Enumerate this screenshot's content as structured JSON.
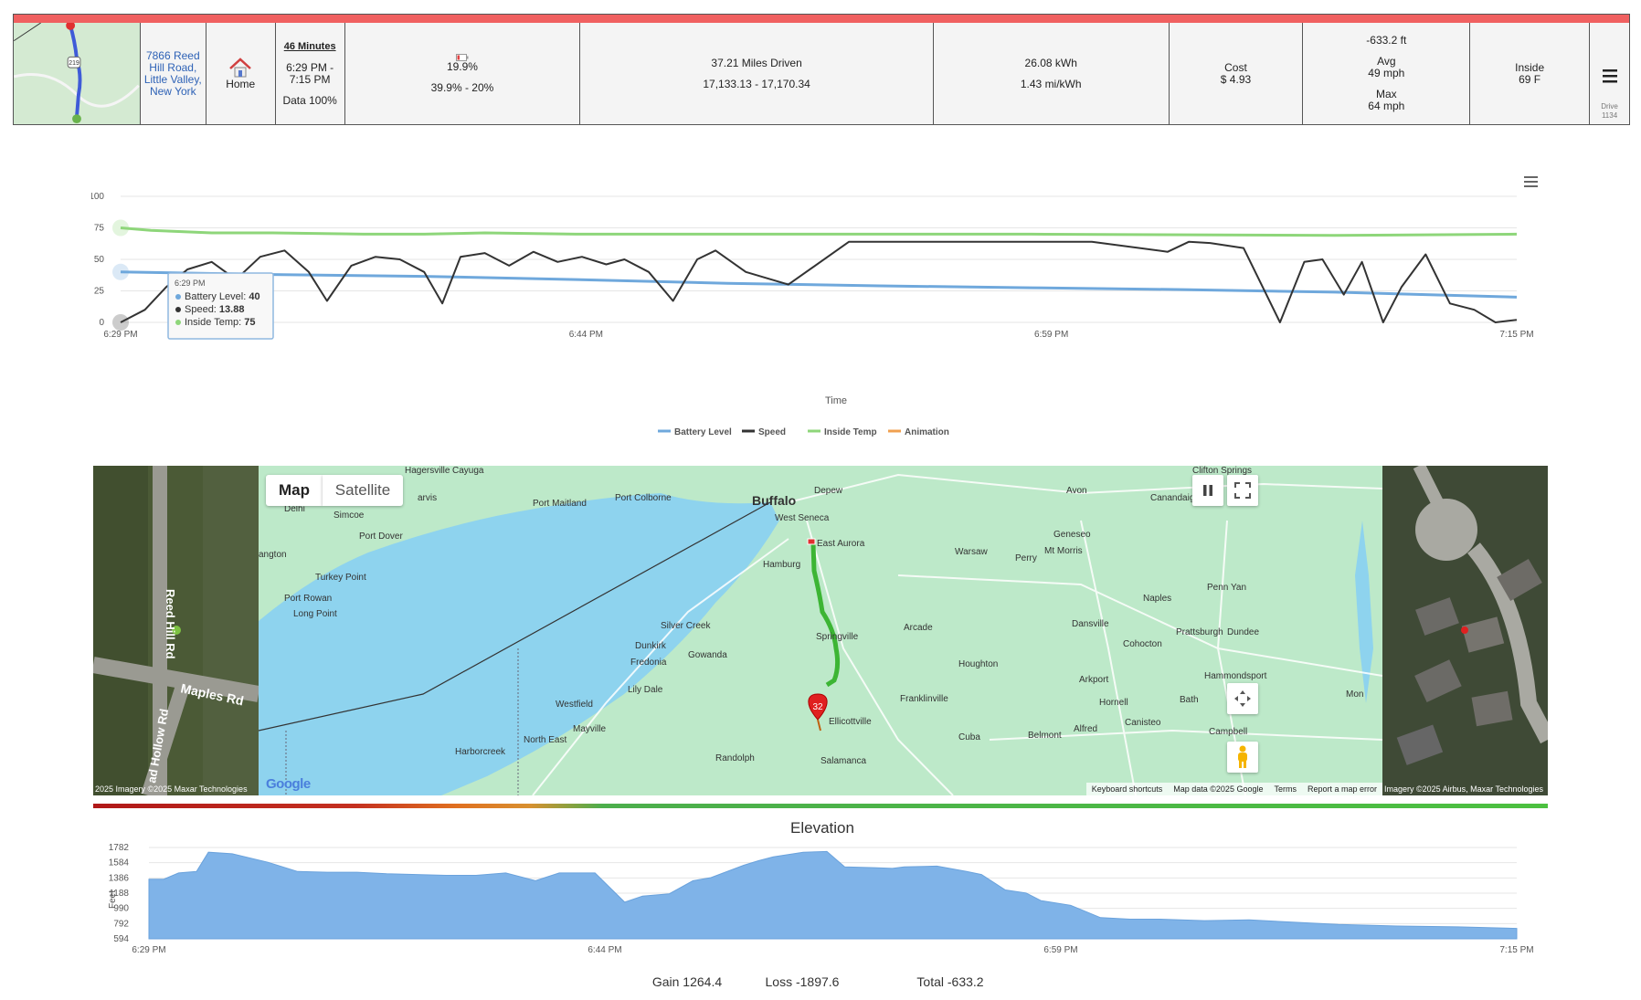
{
  "summary": {
    "address": "7866 Reed Hill Road, Little Valley, New York",
    "home_label": "Home",
    "duration": "46 Minutes",
    "time_range": "6:29 PM - 7:15 PM",
    "data_pct": "Data 100%",
    "battery_now": "19.9%",
    "battery_range": "39.9% - 20%",
    "miles_driven": "37.21 Miles Driven",
    "odometer": "17,133.13 - 17,170.34",
    "energy": "26.08 kWh",
    "efficiency": "1.43 mi/kWh",
    "cost_label": "Cost",
    "cost_value": "$ 4.93",
    "elevation_change": "-633.2 ft",
    "avg_label": "Avg",
    "avg_speed": "49 mph",
    "max_label": "Max",
    "max_speed": "64 mph",
    "inside_label": "Inside",
    "inside_temp": "69 F",
    "drive_label": "Drive",
    "drive_id": "1134",
    "map_route_label": "219"
  },
  "chart_data": [
    {
      "type": "line",
      "xlabel": "Time",
      "x_ticks": [
        "6:29 PM",
        "6:44 PM",
        "6:59 PM",
        "7:15 PM"
      ],
      "y_ticks": [
        "0",
        "25",
        "50",
        "75",
        "100"
      ],
      "ylim": [
        0,
        100
      ],
      "x_minutes_range": [
        0,
        46
      ],
      "legend_position": "bottom",
      "series": [
        {
          "name": "Battery Level",
          "color": "#6fa8dc",
          "x": [
            0,
            5,
            10,
            15,
            20,
            25,
            30,
            35,
            40,
            43,
            46
          ],
          "y": [
            40,
            38,
            36.5,
            34,
            31,
            29,
            27.5,
            26,
            24,
            22,
            20
          ]
        },
        {
          "name": "Speed",
          "color": "#333333",
          "x": [
            0,
            0.8,
            1.5,
            2.2,
            3.0,
            3.8,
            4.6,
            5.4,
            6.2,
            6.8,
            7.6,
            8.4,
            9.2,
            10.0,
            10.6,
            11.2,
            12.0,
            12.8,
            13.6,
            14.4,
            15.2,
            16.0,
            16.6,
            17.4,
            18.2,
            19.0,
            19.6,
            20.6,
            22.0,
            24.0,
            26.0,
            28.0,
            30.0,
            32.0,
            34.5,
            35.2,
            35.9,
            37.0,
            38.2,
            39.0,
            39.6,
            40.3,
            40.9,
            41.6,
            42.2,
            43.0,
            43.8,
            44.6,
            45.3,
            46.0
          ],
          "y": [
            0,
            10,
            28,
            42,
            48,
            34,
            52,
            57,
            40,
            17,
            45,
            52,
            50,
            40,
            15,
            52,
            55,
            45,
            56,
            48,
            52,
            46,
            50,
            40,
            17,
            50,
            57,
            40,
            30,
            64,
            64,
            64,
            64,
            64,
            56,
            64,
            63,
            59,
            0,
            48,
            50,
            22,
            48,
            0,
            28,
            54,
            15,
            10,
            0,
            2
          ]
        },
        {
          "name": "Inside Temp",
          "color": "#8ed67a",
          "x": [
            0,
            1,
            2,
            3,
            5,
            8,
            10,
            12,
            15,
            20,
            30,
            40,
            46
          ],
          "y": [
            75,
            73,
            72,
            71,
            71,
            70,
            70,
            71,
            70,
            70,
            70,
            69,
            70
          ]
        },
        {
          "name": "Animation",
          "color": "#f0a050",
          "x": [],
          "y": []
        }
      ],
      "tooltip": {
        "time": "6:29 PM",
        "lines": [
          {
            "label": "Battery Level:",
            "value": "40",
            "color": "#6fa8dc"
          },
          {
            "label": "Speed:",
            "value": "13.88",
            "color": "#333333"
          },
          {
            "label": "Inside Temp:",
            "value": "75",
            "color": "#8ed67a"
          }
        ]
      }
    },
    {
      "type": "area",
      "title": "Elevation",
      "ylabel": "Feet",
      "x_ticks": [
        "6:29 PM",
        "6:44 PM",
        "6:59 PM",
        "7:15 PM"
      ],
      "y_ticks": [
        "594",
        "792",
        "990",
        "1188",
        "1386",
        "1584",
        "1782"
      ],
      "ylim": [
        594,
        1782
      ],
      "color": "#7fb3e8",
      "x": [
        0,
        0.5,
        1.0,
        1.6,
        2.0,
        2.8,
        4.0,
        5.0,
        6.0,
        7.0,
        8.0,
        10.0,
        11.0,
        12.0,
        13.0,
        13.8,
        15.0,
        16.0,
        16.6,
        17.5,
        18.3,
        18.9,
        20.0,
        20.5,
        21.0,
        22.0,
        22.8,
        23.4,
        24.4,
        25.0,
        25.4,
        26.5,
        27.5,
        28.0,
        28.8,
        29.5,
        30.0,
        31.0,
        32.0,
        33.0,
        34.0,
        35.5,
        37.0,
        38.0,
        40.0,
        42.0,
        44.0,
        46.0
      ],
      "values": [
        1370,
        1370,
        1450,
        1470,
        1720,
        1700,
        1590,
        1470,
        1460,
        1460,
        1440,
        1420,
        1420,
        1450,
        1350,
        1450,
        1450,
        1070,
        1150,
        1180,
        1350,
        1390,
        1550,
        1610,
        1660,
        1720,
        1730,
        1530,
        1520,
        1510,
        1530,
        1540,
        1470,
        1430,
        1230,
        1190,
        1090,
        1030,
        870,
        850,
        850,
        830,
        840,
        820,
        780,
        760,
        750,
        730
      ]
    }
  ],
  "chart_summary": {
    "gain": "Gain 1264.4",
    "loss": "Loss -1897.6",
    "total": "Total -633.2"
  },
  "map": {
    "tab_map": "Map",
    "tab_satellite": "Satellite",
    "left_sat_credit": "2025 Imagery ©2025 Maxar Technologies",
    "right_sat_credit": "Imagery ©2025 Airbus, Maxar Technologies",
    "road_reed": "Reed Hill Rd",
    "road_maples": "Maples Rd",
    "road_hollow": "ad Hollow Rd",
    "marker_label": "32",
    "footer_keyboard": "Keyboard shortcuts",
    "footer_data": "Map data ©2025 Google",
    "footer_terms": "Terms",
    "footer_report": "Report a map error",
    "google_logo": "Google",
    "places": [
      "Hagersville",
      "Cayuga",
      "Delhi",
      "Simcoe",
      "Port Colborne",
      "Port Maitland",
      "Buffalo",
      "Depew",
      "West Seneca",
      "East Aurora",
      "Hamburg",
      "Avon",
      "Canandaigua",
      "Clifton Springs",
      "Geneseo",
      "Warsaw",
      "Perry",
      "Mt Morris",
      "Port Dover",
      "angton",
      "Turkey Point",
      "Port Rowan",
      "Long Point",
      "Silver Creek",
      "Dunkirk",
      "Fredonia",
      "Gowanda",
      "Springville",
      "Arcade",
      "Dansville",
      "Naples",
      "Penn Yan",
      "Cohocton",
      "Prattsburgh",
      "Dundee",
      "Hammondsport",
      "Houghton",
      "Arkport",
      "Bath",
      "Hornell",
      "Canisteo",
      "Lily Dale",
      "Franklinville",
      "Westfield",
      "Mayville",
      "Ellicottville",
      "Alfred",
      "Campbell",
      "North East",
      "Cuba",
      "Belmont",
      "Harborcreek",
      "Randolph",
      "Salamanca",
      "arvis",
      "Mon"
    ]
  }
}
